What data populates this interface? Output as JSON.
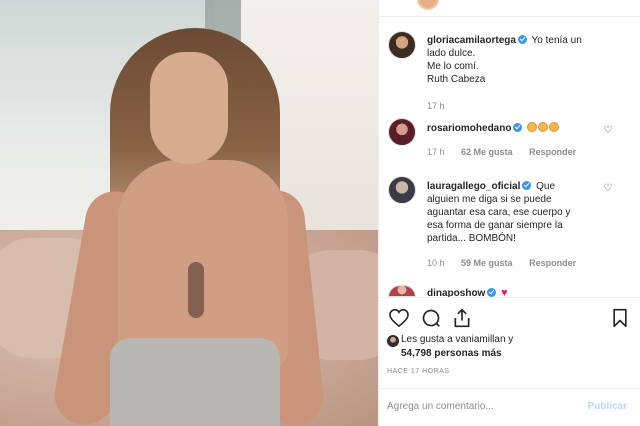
{
  "post": {
    "caption": {
      "username": "gloriacamilaortega",
      "lines": [
        "Yo tenía un",
        "lado dulce.",
        "Me lo comí.",
        "Ruth Cabeza"
      ],
      "time": "17 h"
    },
    "comments": [
      {
        "username": "rosariomohedano",
        "emoji": [
          "heart-eyes-emoji",
          "heart-eyes-emoji",
          "heart-eyes-emoji"
        ],
        "time": "17 h",
        "likes": "62 Me gusta",
        "reply": "Responder"
      },
      {
        "username": "lauragallego_oficial",
        "lines": [
          "Que",
          "alguien me diga si se puede",
          "aguantar esa cara, ese cuerpo y",
          "esa forma de ganar siempre la",
          "partida... BOMBÓN!"
        ],
        "time": "10 h",
        "likes": "59 Me gusta",
        "reply": "Responder"
      },
      {
        "username": "dinaposhow",
        "emoji": [
          "red-heart-emoji"
        ]
      }
    ],
    "likes_line1": "Les gusta a vaniamillan y",
    "likes_line2": "54,798 personas más",
    "time_ago": "HACE 17 HORAS",
    "add_comment_placeholder": "Agrega un comentario...",
    "publish_label": "Publicar"
  },
  "icons": {
    "like": "heart-outline-icon",
    "comment": "comment-bubble-icon",
    "share": "share-icon",
    "save": "bookmark-icon",
    "comment_like": "small-heart-outline-icon"
  },
  "colors": {
    "verified": "#3897f0",
    "publish_disabled": "#b3dbff",
    "meta_text": "#8e8e8e"
  }
}
